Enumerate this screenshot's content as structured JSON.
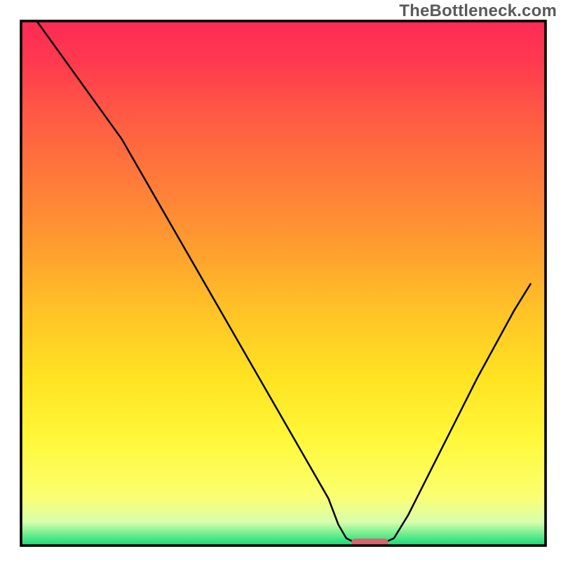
{
  "watermark": "TheBottleneck.com",
  "chart_data": {
    "type": "area",
    "title": "",
    "xlabel": "",
    "ylabel": "",
    "x_range": [
      0,
      1
    ],
    "y_range": [
      0,
      1
    ],
    "gradient_stops": [
      {
        "offset": 0.0,
        "color": "#ff2a55"
      },
      {
        "offset": 0.08,
        "color": "#ff3a4f"
      },
      {
        "offset": 0.18,
        "color": "#ff5a44"
      },
      {
        "offset": 0.3,
        "color": "#ff7a3a"
      },
      {
        "offset": 0.42,
        "color": "#ff9a30"
      },
      {
        "offset": 0.55,
        "color": "#ffc227"
      },
      {
        "offset": 0.68,
        "color": "#ffe322"
      },
      {
        "offset": 0.8,
        "color": "#fff83a"
      },
      {
        "offset": 0.905,
        "color": "#fbff70"
      },
      {
        "offset": 0.955,
        "color": "#d8ffad"
      },
      {
        "offset": 0.992,
        "color": "#30e37d"
      },
      {
        "offset": 1.0,
        "color": "#1bd873"
      }
    ],
    "curve_points": [
      {
        "x": 0.03,
        "y": 1.0
      },
      {
        "x": 0.192,
        "y": 0.775
      },
      {
        "x": 0.215,
        "y": 0.735
      },
      {
        "x": 0.586,
        "y": 0.09
      },
      {
        "x": 0.605,
        "y": 0.04
      },
      {
        "x": 0.62,
        "y": 0.014
      },
      {
        "x": 0.636,
        "y": 0.006
      },
      {
        "x": 0.693,
        "y": 0.006
      },
      {
        "x": 0.711,
        "y": 0.014
      },
      {
        "x": 0.738,
        "y": 0.058
      },
      {
        "x": 0.802,
        "y": 0.185
      },
      {
        "x": 0.87,
        "y": 0.32
      },
      {
        "x": 0.94,
        "y": 0.448
      },
      {
        "x": 0.972,
        "y": 0.5
      }
    ],
    "marker": {
      "x0": 0.63,
      "x1": 0.7,
      "y": 0.006
    },
    "annotations": []
  }
}
